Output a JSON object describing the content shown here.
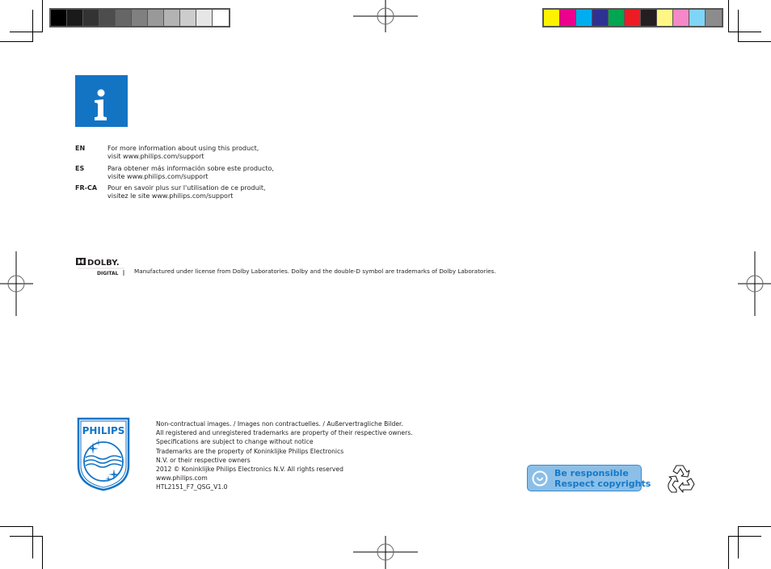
{
  "color_bars": {
    "grayscale": [
      "#000000",
      "#1a1a1a",
      "#333333",
      "#4d4d4d",
      "#666666",
      "#808080",
      "#999999",
      "#b3b3b3",
      "#cccccc",
      "#e6e6e6",
      "#ffffff"
    ],
    "process": [
      "#fff200",
      "#ec008c",
      "#00aeef",
      "#2e3192",
      "#00a651",
      "#ed1c24",
      "#231f20",
      "#fff685",
      "#f488c8",
      "#7fd5f7",
      "#8c8c8c"
    ]
  },
  "info_icon": {
    "icon": "info-icon",
    "color": "#1474c4"
  },
  "support": [
    {
      "code": "EN",
      "line1": "For more information about using this product,",
      "line2": "visit www.philips.com/support"
    },
    {
      "code": "ES",
      "line1": "Para obtener más información sobre este producto,",
      "line2": "visite www.philips.com/support"
    },
    {
      "code": "FR-CA",
      "line1": "Pour en savoir plus sur l'utilisation de ce produit,",
      "line2": "visitez le site www.philips.com/support"
    }
  ],
  "dolby": {
    "logo_word": "DOLBY.",
    "logo_sub": "DIGITAL",
    "notice": "Manufactured under license from Dolby Laboratories. Dolby and the double-D symbol are trademarks of Dolby Laboratories."
  },
  "philips": {
    "brand": "PHILIPS",
    "brand_color": "#1474c4",
    "legal_lines": [
      "Non-contractual images. / Images non contractuelles. / Außervertragliche Bilder.",
      "All registered and unregistered trademarks are property of their respective owners.",
      "Specifications are subject to change without notice",
      "Trademarks are the property of Koninklijke Philips Electronics",
      "N.V. or their respective owners",
      "2012 © Koninklijke Philips Electronics N.V.  All rights reserved",
      "www.philips.com",
      "HTL2151_F7_QSG_V1.0"
    ]
  },
  "badge": {
    "line1": "Be responsible",
    "line2": "Respect copyrights",
    "icon": "smiley-icon"
  },
  "recycle": {
    "icon": "recycle-icon"
  }
}
